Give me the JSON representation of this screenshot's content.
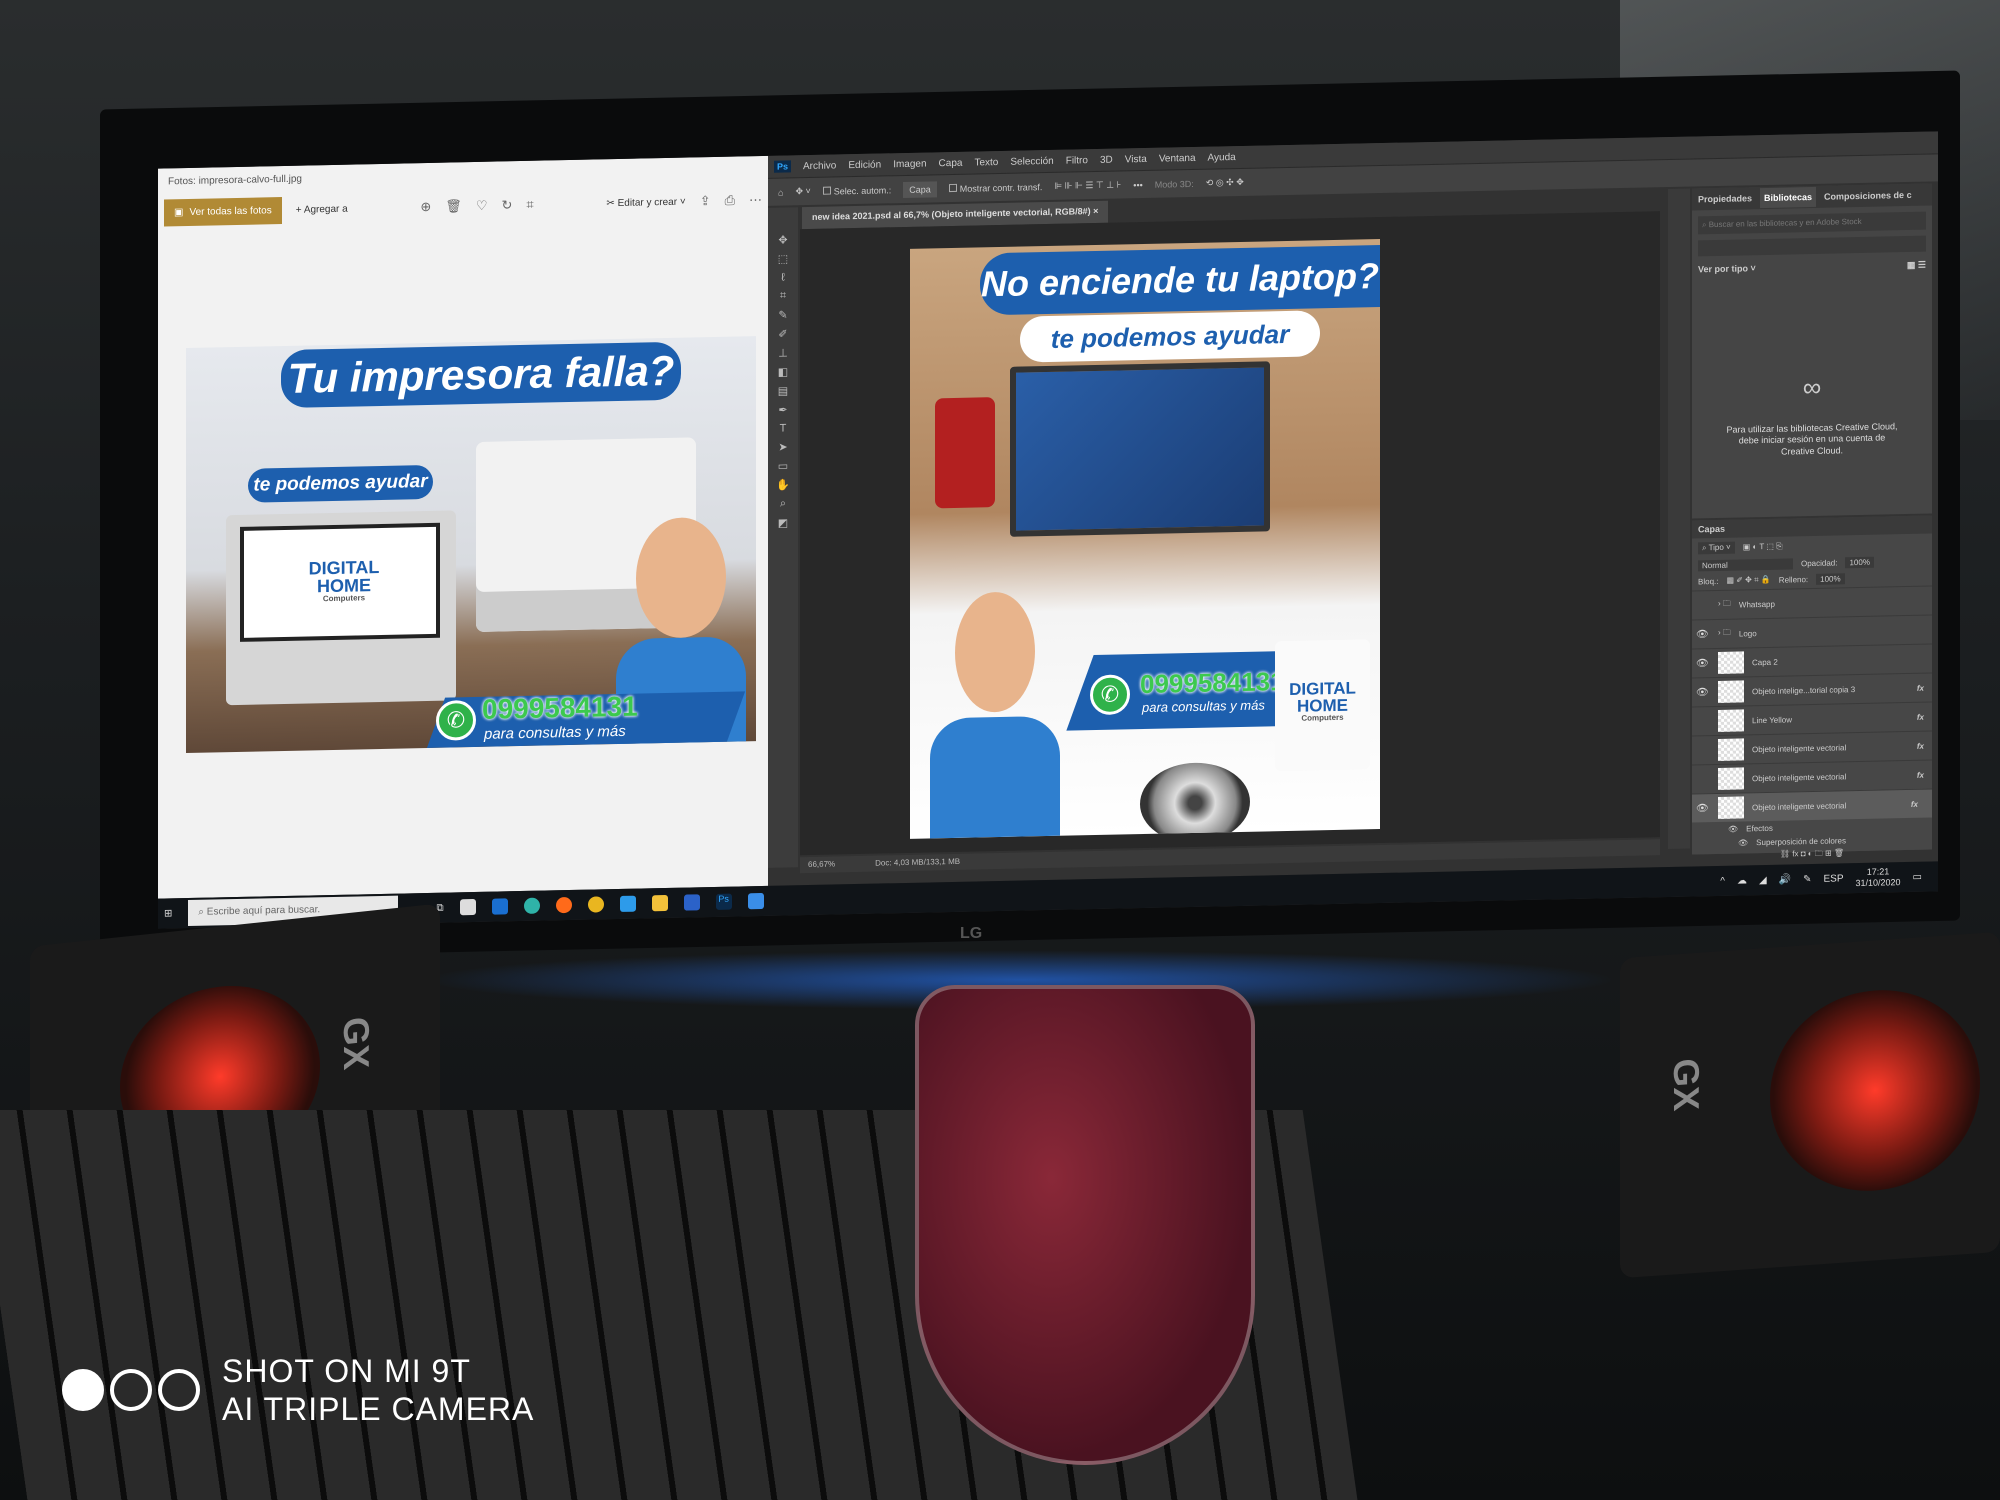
{
  "photos": {
    "title": "Fotos: impresora-calvo-full.jpg",
    "view_all": "Ver todas las fotos",
    "add_to": "Agregar a",
    "edit_create": "Editar y crear",
    "ad": {
      "headline": "Tu impresora falla?",
      "sub": "te podemos ayudar",
      "logo_line1": "DIGITAL",
      "logo_line2": "HOME",
      "logo_line3": "Computers",
      "phone": "0999584131",
      "phone_sub": "para consultas y más"
    }
  },
  "photoshop": {
    "logo": "Ps",
    "menu": [
      "Archivo",
      "Edición",
      "Imagen",
      "Capa",
      "Texto",
      "Selección",
      "Filtro",
      "3D",
      "Vista",
      "Ventana",
      "Ayuda"
    ],
    "options": {
      "auto_select": "Selec. autom.:",
      "target": "Capa",
      "transform": "Mostrar contr. transf.",
      "mode3d": "Modo 3D:"
    },
    "doc_tab": "new idea 2021.psd al 66,7% (Objeto inteligente vectorial, RGB/8#)",
    "ad": {
      "headline": "No enciende tu laptop?",
      "sub": "te podemos ayudar",
      "phone": "0999584131",
      "phone_sub": "para consultas y más",
      "logo_line1": "DIGITAL",
      "logo_line2": "HOME",
      "logo_line3": "Computers"
    },
    "status": {
      "zoom": "66,67%",
      "doc": "Doc: 4,03 MB/133,1 MB"
    },
    "panel": {
      "tabs": [
        "Propiedades",
        "Bibliotecas",
        "Composiciones de c"
      ],
      "search_placeholder": "Buscar en las bibliotecas y en Adobe Stock",
      "view_by": "Ver por tipo",
      "cc_message": "Para utilizar las bibliotecas Creative Cloud, debe iniciar sesión en una cuenta de Creative Cloud."
    },
    "layers": {
      "title": "Capas",
      "filter": "Tipo",
      "blend": "Normal",
      "opacity_label": "Opacidad:",
      "opacity": "100%",
      "lock_label": "Bloq.:",
      "fill_label": "Relleno:",
      "fill": "100%",
      "items": [
        {
          "name": "Whatsapp",
          "visible": false,
          "group": true,
          "fx": false
        },
        {
          "name": "Logo",
          "visible": true,
          "group": true,
          "fx": false
        },
        {
          "name": "Capa 2",
          "visible": true,
          "group": false,
          "fx": false
        },
        {
          "name": "Objeto intelige...torial copia 3",
          "visible": true,
          "group": false,
          "fx": true
        },
        {
          "name": "Line Yellow",
          "visible": false,
          "group": false,
          "fx": true
        },
        {
          "name": "Objeto inteligente vectorial",
          "visible": false,
          "group": false,
          "fx": true
        },
        {
          "name": "Objeto inteligente vectorial",
          "visible": false,
          "group": false,
          "fx": true
        },
        {
          "name": "Objeto inteligente vectorial",
          "visible": true,
          "group": false,
          "fx": true,
          "selected": true
        }
      ],
      "effects": "Efectos",
      "effect_item": "Superposición de colores"
    }
  },
  "taskbar": {
    "search_placeholder": "Escribe aquí para buscar.",
    "language": "ESP",
    "time": "17:21",
    "date": "31/10/2020"
  },
  "monitor_brand": "LG",
  "speaker_brand": "GX",
  "watermark": {
    "line1": "SHOT ON MI 9T",
    "line2": "AI TRIPLE CAMERA"
  }
}
